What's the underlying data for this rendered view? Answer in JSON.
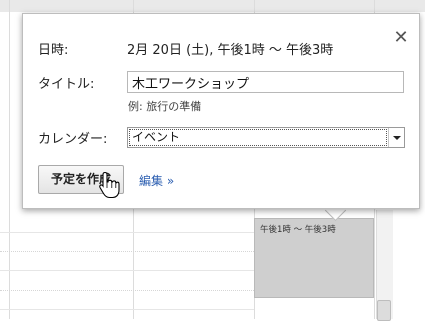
{
  "popup": {
    "datetime_label": "日時:",
    "datetime_value": "2月 20日 (土), 午後1時 ～ 午後3時",
    "title_label": "タイトル:",
    "title_value": "木工ワークショップ",
    "title_hint": "例: 旅行の準備",
    "calendar_label": "カレンダー:",
    "calendar_selected": "イベント",
    "create_button": "予定を作成",
    "edit_link": "編集 »",
    "close_symbol": "✕"
  },
  "calendar": {
    "event_block_text": "午後1時 ～ 午後3時"
  },
  "icons": {
    "close": "close-icon",
    "dropdown": "chevron-down-icon",
    "cursor": "hand-pointer-icon"
  },
  "colors": {
    "link": "#2a5db0",
    "event_block": "#cfcfcf"
  }
}
